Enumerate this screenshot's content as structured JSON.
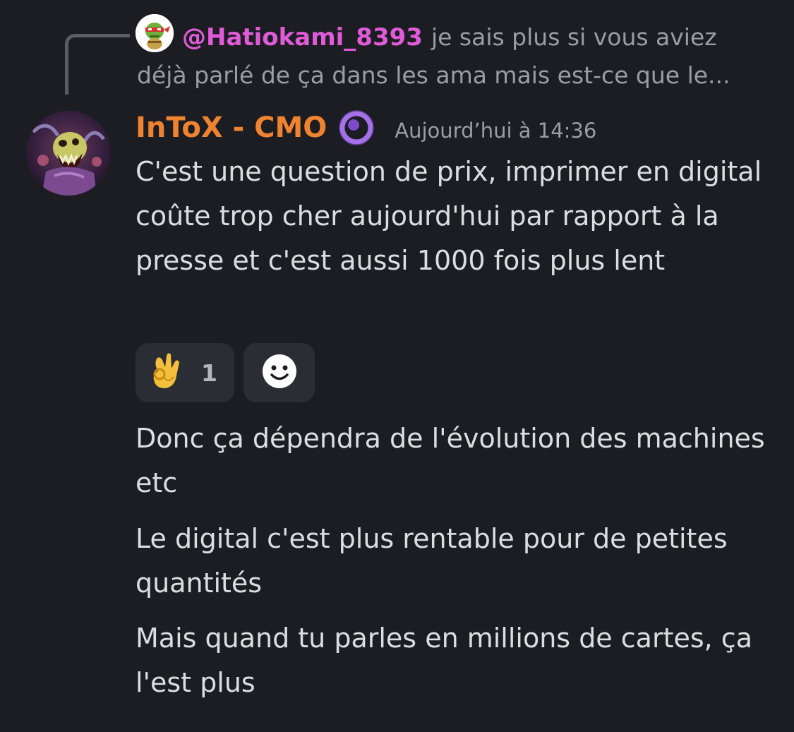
{
  "reply": {
    "mention": "@Hatiokami_8393",
    "snippet": "je sais plus si vous aviez déjà parlé de ça dans les ama mais est-ce que le...",
    "avatar_icon": "turtle-ninja-avatar-icon"
  },
  "message": {
    "author": "InToX - CMO",
    "author_color": "#f0832f",
    "role_icon": "purple-ring-role-icon",
    "timestamp": "Aujourd’hui à 14:36",
    "avatar_icon": "monster-avatar-icon",
    "lines": [
      "C'est une question de prix, imprimer en digital coûte trop cher aujourd'hui par rapport à la presse et c'est aussi 1000 fois plus lent",
      "Donc ça dépendra de l'évolution des machines etc",
      "Le digital c'est plus rentable pour de petites quantités",
      "Mais quand tu parles en millions de cartes, ça l'est plus"
    ]
  },
  "reactions": [
    {
      "emoji_icon": "ok-hand-emoji-icon",
      "count": "1"
    },
    {
      "emoji_icon": "add-reaction-smiley-icon"
    }
  ],
  "colors": {
    "background": "#1c1d23",
    "mention": "#e05bd7",
    "muted_text": "#9b9ca4",
    "reaction_bg": "#2b2d34"
  }
}
